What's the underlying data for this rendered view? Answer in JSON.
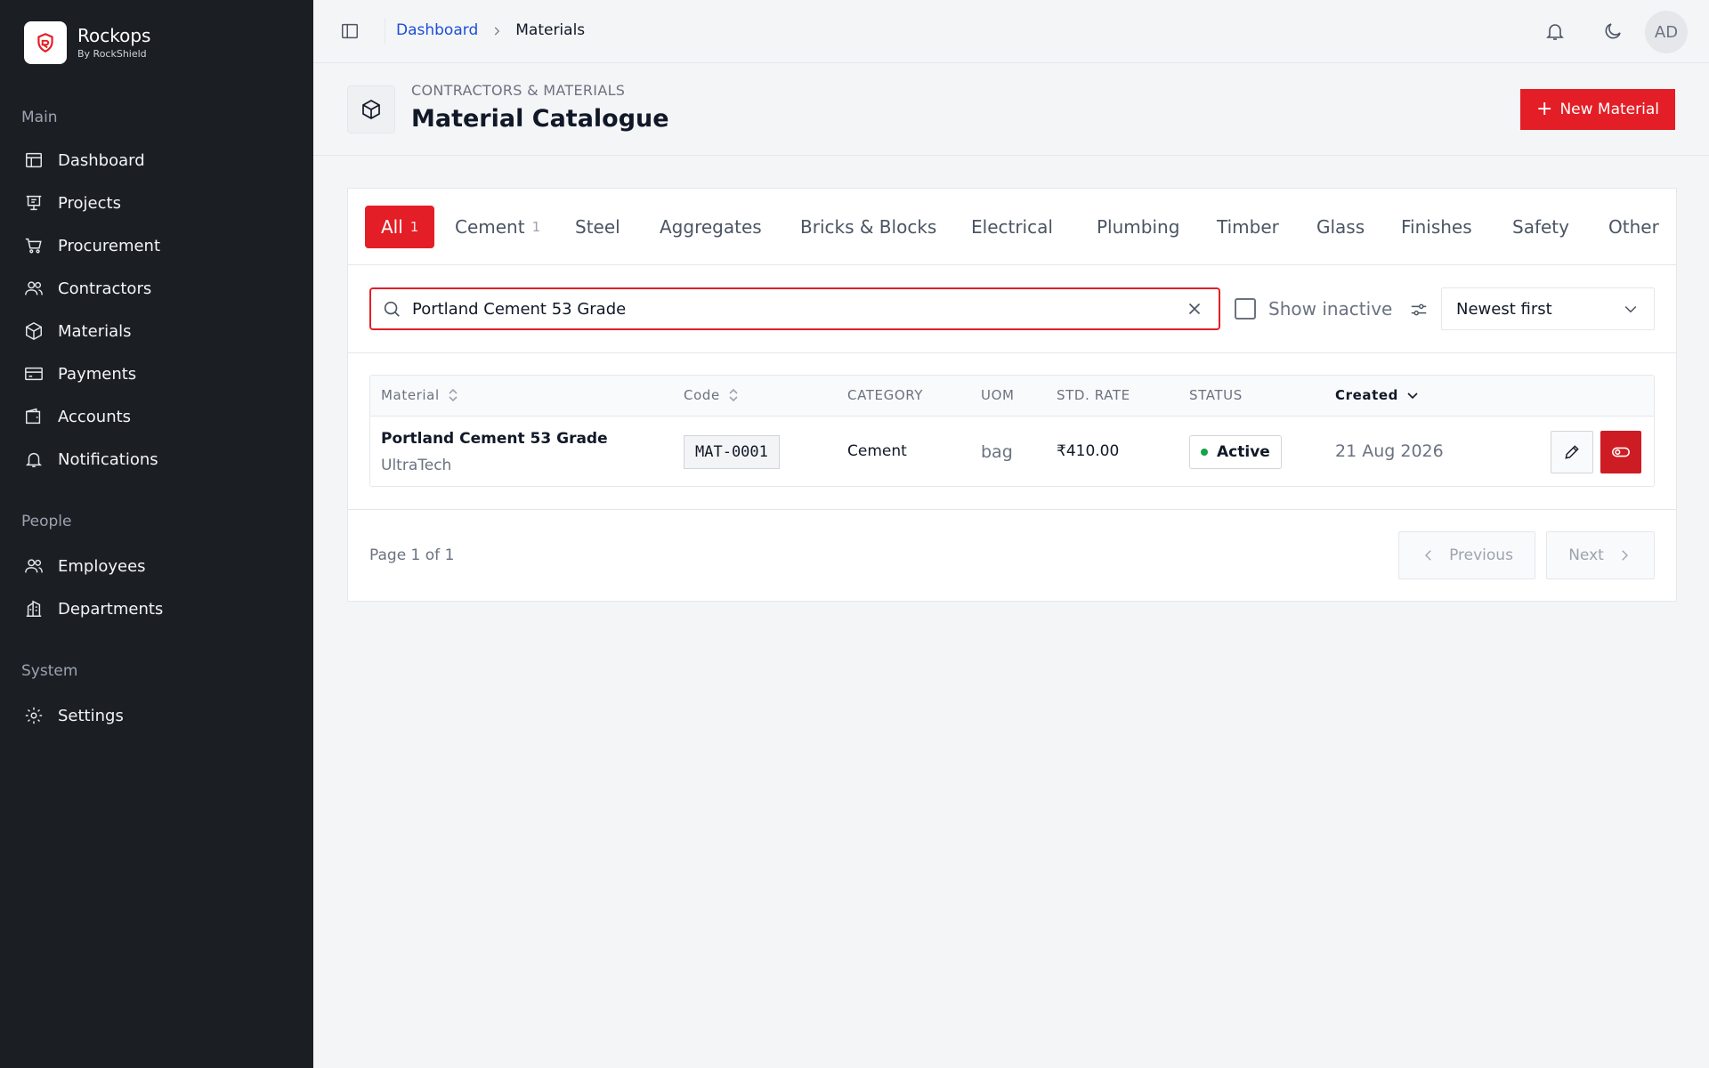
{
  "brand": {
    "name": "Rockops",
    "sub": "By RockShield"
  },
  "sidebar": {
    "sections": [
      {
        "label": "Main"
      },
      {
        "label": "People"
      },
      {
        "label": "System"
      }
    ],
    "items": [
      {
        "label": "Dashboard",
        "icon": "dashboard-icon"
      },
      {
        "label": "Projects",
        "icon": "projects-icon"
      },
      {
        "label": "Procurement",
        "icon": "cart-icon"
      },
      {
        "label": "Contractors",
        "icon": "users-icon"
      },
      {
        "label": "Materials",
        "icon": "box-icon"
      },
      {
        "label": "Payments",
        "icon": "card-icon"
      },
      {
        "label": "Accounts",
        "icon": "wallet-icon"
      },
      {
        "label": "Notifications",
        "icon": "bell-icon"
      },
      {
        "label": "Employees",
        "icon": "users-icon"
      },
      {
        "label": "Departments",
        "icon": "building-icon"
      },
      {
        "label": "Settings",
        "icon": "gear-icon"
      }
    ]
  },
  "topbar": {
    "breadcrumb": {
      "link": "Dashboard",
      "current": "Materials"
    },
    "avatar": "AD"
  },
  "header": {
    "eyebrow": "CONTRACTORS & MATERIALS",
    "title": "Material Catalogue",
    "new_button": "New Material"
  },
  "tabs": [
    {
      "label": "All",
      "count": "1"
    },
    {
      "label": "Cement",
      "count": "1"
    },
    {
      "label": "Steel"
    },
    {
      "label": "Aggregates"
    },
    {
      "label": "Bricks & Blocks"
    },
    {
      "label": "Electrical"
    },
    {
      "label": "Plumbing"
    },
    {
      "label": "Timber"
    },
    {
      "label": "Glass"
    },
    {
      "label": "Finishes"
    },
    {
      "label": "Safety"
    },
    {
      "label": "Other"
    }
  ],
  "filters": {
    "search_value": "Portland Cement 53 Grade",
    "show_inactive_label": "Show inactive",
    "sort_value": "Newest first"
  },
  "table": {
    "columns": {
      "material": "Material",
      "code": "Code",
      "category": "CATEGORY",
      "uom": "UOM",
      "rate": "STD. RATE",
      "status": "STATUS",
      "created": "Created"
    },
    "rows": [
      {
        "name": "Portland Cement 53 Grade",
        "brand": "UltraTech",
        "code": "MAT-0001",
        "category": "Cement",
        "uom": "bag",
        "rate": "₹410.00",
        "status": "Active",
        "created": "21 Aug 2026"
      }
    ]
  },
  "pager": {
    "info": "Page 1 of 1",
    "prev": "Previous",
    "next": "Next"
  },
  "colors": {
    "accent": "#e41e26",
    "sidebar_bg": "#1b1f24",
    "status_active": "#16a34a",
    "link": "#1d4ed8"
  }
}
